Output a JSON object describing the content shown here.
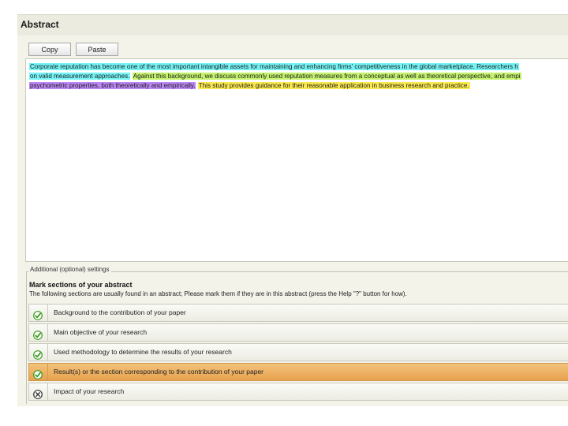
{
  "header": {
    "title": "Abstract"
  },
  "toolbar": {
    "copy_label": "Copy",
    "paste_label": "Paste"
  },
  "abstract": {
    "line1": [
      {
        "text": "Corporate reputation has become one of the most important intangible assets for maintaining and enhancing firms' competitiveness in the global marketplace. Researchers h",
        "highlight": "cyan"
      }
    ],
    "line2": [
      {
        "text": "on valid measurement approaches.",
        "highlight": "cyan"
      },
      {
        "text": "Against this background, we discuss commonly used reputation measures from a conceptual as well as theoretical perspective, and empi",
        "highlight": "green"
      }
    ],
    "line3": [
      {
        "text": "psychometric properties, both theoretically and empirically.",
        "highlight": "purple"
      },
      {
        "text": "This study provides guidance for their reasonable application in business research and practice.",
        "highlight": "yellow"
      }
    ]
  },
  "settings": {
    "legend": "Additional (optional) settings",
    "heading": "Mark sections of your abstract",
    "description": "The following sections are usually found in an abstract; Please mark them if they are in this abstract (press the Help \"?\" button for how).",
    "items": [
      {
        "label": "Background to the contribution of your paper",
        "status": "checked",
        "selected": false
      },
      {
        "label": "Main objective of your research",
        "status": "checked",
        "selected": false
      },
      {
        "label": "Used methodology to determine the results of your research",
        "status": "checked",
        "selected": false
      },
      {
        "label": "Result(s) or the section corresponding to the contribution of your paper",
        "status": "checked",
        "selected": true
      },
      {
        "label": "Impact of your research",
        "status": "unchecked",
        "selected": false
      }
    ]
  },
  "colors": {
    "cyan": "#74f4f6",
    "green": "#c4f26c",
    "purple": "#bc86f4",
    "yellow": "#fbe94f",
    "check_green": "#3a9a1c",
    "selected_row": "#e7a24f"
  }
}
